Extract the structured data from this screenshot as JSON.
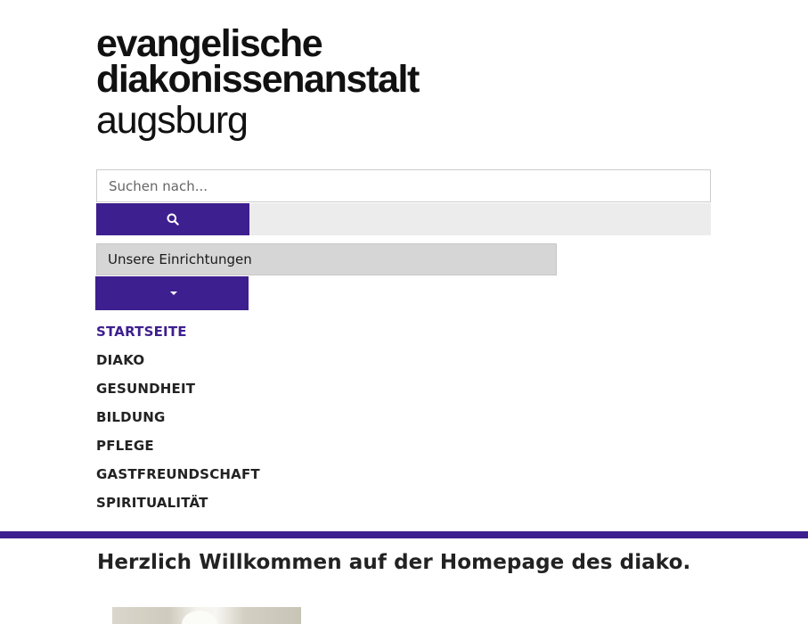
{
  "logo": {
    "line1": "evangelische",
    "line2": "diakonissenanstalt",
    "line3": "augsburg"
  },
  "search": {
    "placeholder": "Suchen nach...",
    "value": "",
    "button_icon": "search-icon"
  },
  "einrichtungen": {
    "selected": "Unsere Einrichtungen",
    "toggle_icon": "caret-down-icon"
  },
  "nav": {
    "items": [
      {
        "label": "STARTSEITE",
        "active": true
      },
      {
        "label": "DIAKO",
        "active": false
      },
      {
        "label": "GESUNDHEIT",
        "active": false
      },
      {
        "label": "BILDUNG",
        "active": false
      },
      {
        "label": "PFLEGE",
        "active": false
      },
      {
        "label": "GASTFREUNDSCHAFT",
        "active": false
      },
      {
        "label": "SPIRITUALITÄT",
        "active": false
      }
    ]
  },
  "main": {
    "heading": "Herzlich Willkommen auf der Homepage des diako."
  },
  "colors": {
    "brand_purple": "#3e1f8f",
    "search_bar_bg": "#ececec",
    "dropdown_bg": "#d6d6d6"
  }
}
